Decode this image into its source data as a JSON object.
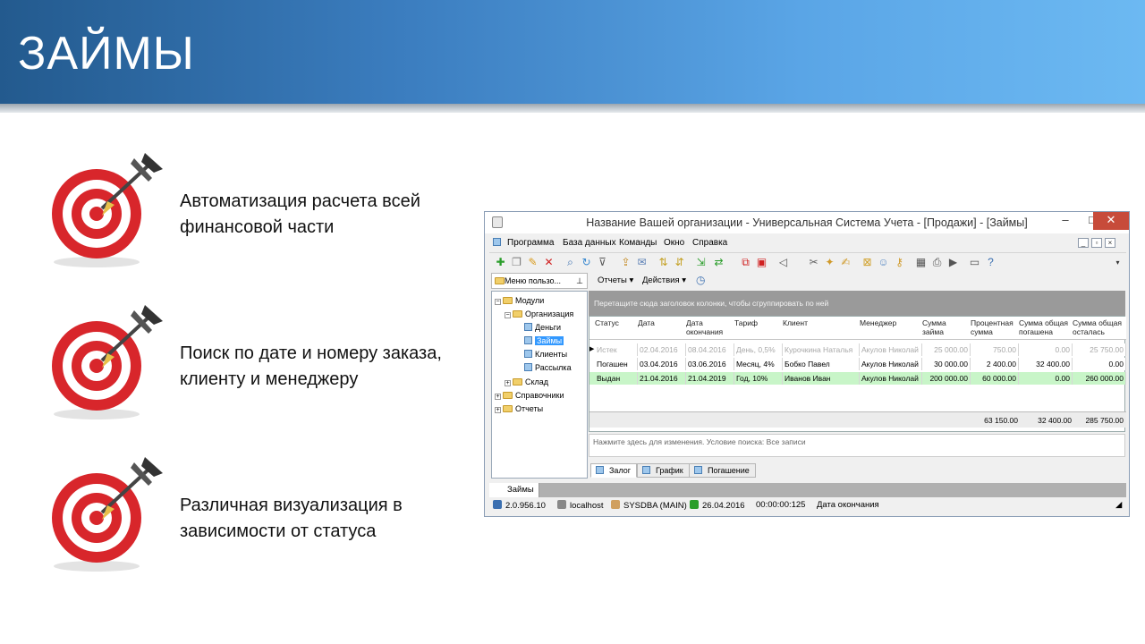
{
  "slide": {
    "title": "ЗАЙМЫ",
    "colors": {
      "banner_start": "#235a8e",
      "banner_end": "#6cb9f2",
      "target_red": "#d8262b"
    },
    "bullets": [
      {
        "line1": "Автоматизация расчета всей",
        "line2": "финансовой части",
        "icon": "target-dart-icon"
      },
      {
        "line1": "Поиск по дате и номеру заказа,",
        "line2": "клиенту и менеджеру",
        "icon": "target-dart-icon"
      },
      {
        "line1": "Различная визуализация в",
        "line2": "зависимости от статуса",
        "icon": "target-dart-icon"
      }
    ]
  },
  "window": {
    "title": "Название Вашей организации - Универсальная Система Учета - [Продажи] - [Займы]",
    "controls": {
      "minimize": "–",
      "maximize": "□",
      "close": "✕"
    },
    "menu": [
      "Программа",
      "База данных",
      "Команды",
      "Окно",
      "Справка"
    ],
    "left_panel": {
      "header": "Меню пользо...",
      "tree": [
        {
          "label": "Модули",
          "level": 0,
          "type": "folder",
          "expander": "−"
        },
        {
          "label": "Организация",
          "level": 1,
          "type": "folder",
          "expander": "−"
        },
        {
          "label": "Деньги",
          "level": 2,
          "type": "doc"
        },
        {
          "label": "Займы",
          "level": 2,
          "type": "doc",
          "selected": true
        },
        {
          "label": "Клиенты",
          "level": 2,
          "type": "doc"
        },
        {
          "label": "Рассылка",
          "level": 2,
          "type": "doc"
        },
        {
          "label": "Склад",
          "level": 1,
          "type": "folder",
          "expander": "+"
        },
        {
          "label": "Справочники",
          "level": 0,
          "type": "folder",
          "expander": "+"
        },
        {
          "label": "Отчеты",
          "level": 0,
          "type": "folder",
          "expander": "+"
        }
      ]
    },
    "right_toolbar": {
      "reports": "Отчеты ▾",
      "actions": "Действия ▾"
    },
    "group_hint": "Перетащите сюда заголовок колонки, чтобы сгруппировать по ней",
    "columns": [
      {
        "l1": "Статус",
        "l2": ""
      },
      {
        "l1": "Дата",
        "l2": ""
      },
      {
        "l1": "Дата",
        "l2": "окончания"
      },
      {
        "l1": "Тариф",
        "l2": ""
      },
      {
        "l1": "Клиент",
        "l2": ""
      },
      {
        "l1": "Менеджер",
        "l2": ""
      },
      {
        "l1": "Сумма",
        "l2": "займа"
      },
      {
        "l1": "Процентная",
        "l2": "сумма"
      },
      {
        "l1": "Сумма общая",
        "l2": "погашена"
      },
      {
        "l1": "Сумма общая",
        "l2": "осталась"
      }
    ],
    "rows": [
      {
        "status_style": "expired",
        "color": "#a8a8a8",
        "bg": "#ffffff",
        "cells": [
          "Истек",
          "02.04.2016",
          "08.04.2016",
          "День, 0,5%",
          "Курочкина Наталья",
          "Акулов Николай",
          "25 000.00",
          "750.00",
          "0.00",
          "25 750.00"
        ]
      },
      {
        "status_style": "repaid",
        "color": "#000000",
        "bg": "#ffffff",
        "cells": [
          "Погашен",
          "03.04.2016",
          "03.06.2016",
          "Месяц, 4%",
          "Бобко Павел",
          "Акулов Николай",
          "30 000.00",
          "2 400.00",
          "32 400.00",
          "0.00"
        ]
      },
      {
        "status_style": "issued",
        "color": "#000000",
        "bg": "#c8f5c8",
        "cells": [
          "Выдан",
          "21.04.2016",
          "21.04.2019",
          "Год, 10%",
          "Иванов Иван",
          "Акулов Николай",
          "200 000.00",
          "60 000.00",
          "0.00",
          "260 000.00"
        ]
      }
    ],
    "totals": {
      "interest": "63 150.00",
      "repaid": "32 400.00",
      "remaining": "285 750.00"
    },
    "filter_text": "Нажмите здесь для изменения. Условие поиска: Все записи",
    "detail_tabs": [
      "Залог",
      "График",
      "Погашение"
    ],
    "doc_tab": "Займы",
    "status": {
      "version": "2.0.956.10",
      "host": "localhost",
      "user": "SYSDBA (MAIN)",
      "date": "26.04.2016",
      "time": "00:00:00:125",
      "field": "Дата окончания"
    }
  }
}
